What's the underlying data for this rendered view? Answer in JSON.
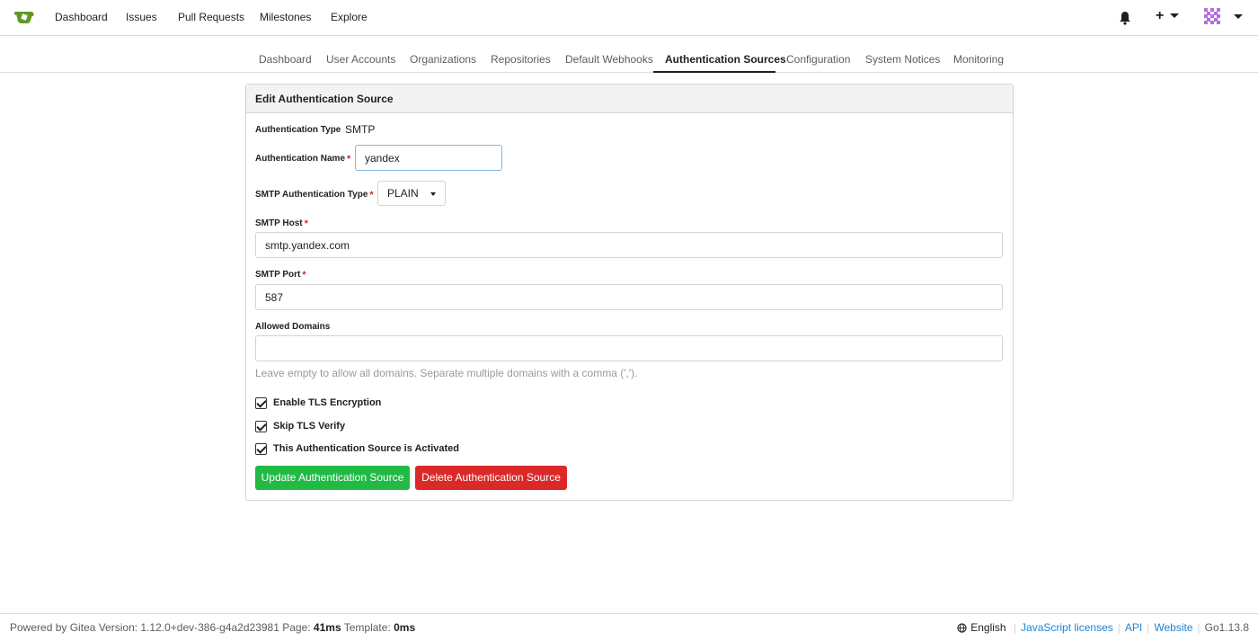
{
  "topnav": {
    "links": [
      "Dashboard",
      "Issues",
      "Pull Requests",
      "Milestones",
      "Explore"
    ],
    "plus_label": "+"
  },
  "admin_tabs": {
    "items": [
      "Dashboard",
      "User Accounts",
      "Organizations",
      "Repositories",
      "Default Webhooks",
      "Authentication Sources",
      "Configuration",
      "System Notices",
      "Monitoring"
    ],
    "active": "Authentication Sources"
  },
  "panel": {
    "title": "Edit Authentication Source",
    "auth_type_label": "Authentication Type",
    "auth_type_value": "SMTP",
    "auth_name_label": "Authentication Name",
    "auth_name_value": "yandex",
    "smtp_auth_type_label": "SMTP Authentication Type",
    "smtp_auth_type_value": "PLAIN",
    "smtp_host_label": "SMTP Host",
    "smtp_host_value": "smtp.yandex.com",
    "smtp_port_label": "SMTP Port",
    "smtp_port_value": "587",
    "allowed_domains_label": "Allowed Domains",
    "allowed_domains_value": "",
    "allowed_domains_help": "Leave empty to allow all domains. Separate multiple domains with a comma (',').",
    "required_mark": "*",
    "checkboxes": [
      {
        "label": "Enable TLS Encryption",
        "checked": true
      },
      {
        "label": "Skip TLS Verify",
        "checked": true
      },
      {
        "label": "This Authentication Source is Activated",
        "checked": true
      }
    ],
    "update_button": "Update Authentication Source",
    "delete_button": "Delete Authentication Source"
  },
  "footer": {
    "powered_prefix": "Powered by Gitea Version: 1.12.0+dev-386-g4a2d23981 Page: ",
    "page_time": "41ms",
    "template_prefix": " Template: ",
    "template_time": "0ms",
    "language": "English",
    "js_licenses": "JavaScript licenses",
    "api": "API",
    "website": "Website",
    "go_version": "Go1.13.8"
  },
  "colors": {
    "green_button": "#21ba45",
    "red_button": "#db2828",
    "link": "#2185d0",
    "logo_green": "#609926"
  }
}
